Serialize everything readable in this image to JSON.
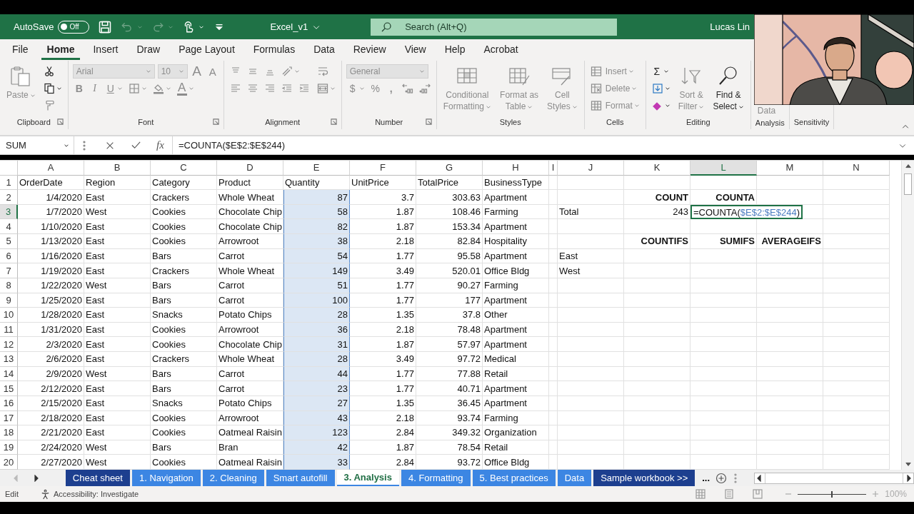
{
  "title_bar": {
    "autosave_label": "AutoSave",
    "autosave": {
      "on": false,
      "label": "Off"
    },
    "quick_access": [
      {
        "kind": "save",
        "disabled": false
      },
      {
        "kind": "undo",
        "disabled": true,
        "dropdown": true
      },
      {
        "kind": "redo",
        "disabled": true,
        "dropdown": true
      },
      {
        "kind": "touch",
        "disabled": false,
        "dropdown": true
      },
      {
        "kind": "customize",
        "disabled": false
      }
    ],
    "title": "Excel_v1",
    "search_placeholder": "Search (Alt+Q)",
    "user": "Lucas Lin"
  },
  "menu_tabs": [
    {
      "label": "File",
      "selected": false
    },
    {
      "label": "Home",
      "selected": true
    },
    {
      "label": "Insert",
      "selected": false
    },
    {
      "label": "Draw",
      "selected": false
    },
    {
      "label": "Page Layout",
      "selected": false
    },
    {
      "label": "Formulas",
      "selected": false
    },
    {
      "label": "Data",
      "selected": false
    },
    {
      "label": "Review",
      "selected": false
    },
    {
      "label": "View",
      "selected": false
    },
    {
      "label": "Help",
      "selected": false
    },
    {
      "label": "Acrobat",
      "selected": false
    }
  ],
  "ribbon": {
    "groups": [
      {
        "label": "Clipboard",
        "launcher": true,
        "columns": [
          [
            [
              {
                "kind": "paste",
                "label": [
                  "Paste"
                ],
                "disabled": true,
                "dropdown": true
              }
            ]
          ],
          [
            [
              {
                "kind": "cut",
                "disabled": false
              }
            ],
            [
              {
                "kind": "copy",
                "disabled": false,
                "dropdown": true
              }
            ],
            [
              {
                "kind": "painter",
                "disabled": true
              }
            ]
          ]
        ]
      },
      {
        "label": "Font",
        "launcher": true,
        "columns": [
          [
            [
              {
                "kind": "font-combo",
                "value": "Arial",
                "disabled": true
              },
              {
                "kind": "size-combo",
                "value": "10",
                "disabled": true
              },
              {
                "kind": "grow-glyph",
                "text": "A",
                "disabled": true
              },
              {
                "kind": "shrink-glyph",
                "text": "A",
                "disabled": true
              }
            ],
            [
              {
                "kind": "bold-glyph",
                "text": "B",
                "disabled": true
              },
              {
                "kind": "italic-glyph",
                "text": "I",
                "disabled": true
              },
              {
                "kind": "underline-glyph",
                "text": "U",
                "disabled": true,
                "dropdown": true
              },
              {
                "kind": "borders",
                "disabled": true,
                "dropdown": true
              },
              {
                "kind": "fill",
                "disabled": true,
                "dropdown": true
              },
              {
                "kind": "color-glyph",
                "text": "A",
                "disabled": true,
                "dropdown": true
              }
            ]
          ]
        ]
      },
      {
        "label": "Alignment",
        "launcher": true,
        "columns": [
          [
            [
              {
                "kind": "align-top",
                "disabled": true
              },
              {
                "kind": "align-middle",
                "disabled": true
              },
              {
                "kind": "align-bottom",
                "disabled": true
              },
              {
                "kind": "orientation",
                "disabled": true,
                "dropdown": true
              }
            ],
            [
              {
                "kind": "align-left",
                "disabled": true
              },
              {
                "kind": "align-center",
                "disabled": true
              },
              {
                "kind": "align-right",
                "disabled": true
              },
              {
                "kind": "outdent",
                "disabled": true
              },
              {
                "kind": "indent",
                "disabled": true
              }
            ]
          ],
          [
            [
              {
                "kind": "wrap",
                "disabled": true
              }
            ],
            [
              {
                "kind": "merge",
                "disabled": true,
                "dropdown": true
              }
            ]
          ]
        ]
      },
      {
        "label": "Number",
        "launcher": true,
        "columns": [
          [
            [
              {
                "kind": "format-combo",
                "value": "General",
                "disabled": true
              }
            ],
            [
              {
                "kind": "plain-glyph",
                "text": "$",
                "disabled": true,
                "dropdown": true
              },
              {
                "kind": "plain-glyph",
                "text": "%",
                "disabled": true
              },
              {
                "kind": "bold-glyph",
                "text": ",",
                "disabled": true
              },
              {
                "kind": "decimal-more",
                "disabled": true
              },
              {
                "kind": "decimal-less",
                "disabled": true
              }
            ]
          ]
        ]
      },
      {
        "label": "Styles",
        "launcher": false,
        "columns": [
          [
            [
              {
                "kind": "conditional",
                "label": [
                  "Conditional",
                  "Formatting"
                ],
                "disabled": true,
                "dropdown": true
              }
            ]
          ],
          [
            [
              {
                "kind": "table",
                "label": [
                  "Format as",
                  "Table"
                ],
                "disabled": true,
                "dropdown": true
              }
            ]
          ],
          [
            [
              {
                "kind": "styles",
                "label": [
                  "Cell",
                  "Styles"
                ],
                "disabled": true,
                "dropdown": true
              }
            ]
          ]
        ]
      },
      {
        "label": "Cells",
        "launcher": false,
        "columns": [
          [
            [
              {
                "kind": "insert-cells",
                "label": [
                  "Insert"
                ],
                "disabled": true,
                "dropdown": true
              }
            ],
            [
              {
                "kind": "delete-cells",
                "label": [
                  "Delete"
                ],
                "disabled": true,
                "dropdown": true
              }
            ],
            [
              {
                "kind": "format-cells",
                "label": [
                  "Format"
                ],
                "disabled": true,
                "dropdown": true
              }
            ]
          ]
        ]
      },
      {
        "label": "Editing",
        "launcher": false,
        "columns": [
          [
            [
              {
                "kind": "plain-glyph",
                "text": "Σ",
                "disabled": false,
                "dropdown": true
              }
            ],
            [
              {
                "kind": "fill-down",
                "disabled": false,
                "dropdown": true
              }
            ],
            [
              {
                "kind": "clear",
                "disabled": false,
                "dropdown": true
              }
            ]
          ],
          [
            [
              {
                "kind": "sort",
                "label": [
                  "Sort &",
                  "Filter"
                ],
                "disabled": true,
                "dropdown": true
              }
            ]
          ],
          [
            [
              {
                "kind": "find",
                "label": [
                  "Find &",
                  "Select"
                ],
                "disabled": false,
                "dropdown": true
              }
            ]
          ]
        ]
      },
      {
        "label": "Analysis",
        "launcher": false,
        "columns": [
          [
            [
              {
                "kind": "hidden",
                "label": [
                  "Data"
                ],
                "disabled": true
              }
            ]
          ]
        ]
      },
      {
        "label": "Sensitivity",
        "launcher": false
      }
    ]
  },
  "formula_bar": {
    "name_box": "SUM",
    "function_label": "fx",
    "formula": "=COUNTA($E$2:$E$244)"
  },
  "grid": {
    "columns": [
      {
        "letter": "A",
        "kind": "number",
        "selected": false,
        "referenced": false
      },
      {
        "letter": "B",
        "kind": "text",
        "selected": false,
        "referenced": false
      },
      {
        "letter": "C",
        "kind": "text",
        "selected": false,
        "referenced": false
      },
      {
        "letter": "D",
        "kind": "text",
        "selected": false,
        "referenced": false
      },
      {
        "letter": "E",
        "kind": "number",
        "selected": false,
        "referenced": true
      },
      {
        "letter": "F",
        "kind": "number",
        "selected": false,
        "referenced": false
      },
      {
        "letter": "G",
        "kind": "number",
        "selected": false,
        "referenced": false
      },
      {
        "letter": "H",
        "kind": "text",
        "selected": false,
        "referenced": false
      },
      {
        "letter": "I",
        "kind": "text",
        "selected": false,
        "referenced": false
      },
      {
        "letter": "J",
        "kind": "text",
        "selected": false,
        "referenced": false
      },
      {
        "letter": "K",
        "kind": "number",
        "selected": false,
        "referenced": false
      },
      {
        "letter": "L",
        "kind": "number",
        "selected": true,
        "referenced": false
      },
      {
        "letter": "M",
        "kind": "number",
        "selected": false,
        "referenced": false
      },
      {
        "letter": "N",
        "kind": "text",
        "selected": false,
        "referenced": false
      }
    ],
    "rows": [
      {
        "number": "1",
        "kind": "header",
        "selected": false,
        "cells": {
          "A": "OrderDate",
          "B": "Region",
          "C": "Category",
          "D": "Product",
          "E": "Quantity",
          "F": "UnitPrice",
          "G": "TotalPrice",
          "H": "BusinessType"
        }
      },
      {
        "number": "2",
        "kind": "data",
        "selected": false,
        "cells": {
          "A": "1/4/2020",
          "B": "East",
          "C": "Crackers",
          "D": "Whole Wheat",
          "E": "87",
          "F": "3.7",
          "G": "303.63",
          "H": "Apartment",
          "K": {
            "text": "COUNT",
            "bold": true
          },
          "L": {
            "text": "COUNTA",
            "bold": true
          }
        }
      },
      {
        "number": "3",
        "kind": "data",
        "selected": true,
        "cells": {
          "A": "1/7/2020",
          "B": "West",
          "C": "Cookies",
          "D": "Chocolate Chip",
          "E": "58",
          "F": "1.87",
          "G": "108.46",
          "H": "Farming",
          "J": "Total",
          "K": "243",
          "L": {
            "parts": [
              {
                "text": "=COUNTA(",
                "ref": false
              },
              {
                "text": "$E$2:$E$244",
                "ref": true
              },
              {
                "text": ")",
                "ref": false
              }
            ]
          }
        }
      },
      {
        "number": "4",
        "kind": "data",
        "selected": false,
        "cells": {
          "A": "1/10/2020",
          "B": "East",
          "C": "Cookies",
          "D": "Chocolate Chip",
          "E": "82",
          "F": "1.87",
          "G": "153.34",
          "H": "Apartment"
        }
      },
      {
        "number": "5",
        "kind": "data",
        "selected": false,
        "cells": {
          "A": "1/13/2020",
          "B": "East",
          "C": "Cookies",
          "D": "Arrowroot",
          "E": "38",
          "F": "2.18",
          "G": "82.84",
          "H": "Hospitality",
          "K": {
            "text": "COUNTIFS",
            "bold": true
          },
          "L": {
            "text": "SUMIFS",
            "bold": true
          },
          "M": {
            "text": "AVERAGEIFS",
            "bold": true
          }
        }
      },
      {
        "number": "6",
        "kind": "data",
        "selected": false,
        "cells": {
          "A": "1/16/2020",
          "B": "East",
          "C": "Bars",
          "D": "Carrot",
          "E": "54",
          "F": "1.77",
          "G": "95.58",
          "H": "Apartment",
          "J": "East"
        }
      },
      {
        "number": "7",
        "kind": "data",
        "selected": false,
        "cells": {
          "A": "1/19/2020",
          "B": "East",
          "C": "Crackers",
          "D": "Whole Wheat",
          "E": "149",
          "F": "3.49",
          "G": "520.01",
          "H": "Office Bldg",
          "J": "West"
        }
      },
      {
        "number": "8",
        "kind": "data",
        "selected": false,
        "cells": {
          "A": "1/22/2020",
          "B": "West",
          "C": "Bars",
          "D": "Carrot",
          "E": "51",
          "F": "1.77",
          "G": "90.27",
          "H": "Farming"
        }
      },
      {
        "number": "9",
        "kind": "data",
        "selected": false,
        "cells": {
          "A": "1/25/2020",
          "B": "East",
          "C": "Bars",
          "D": "Carrot",
          "E": "100",
          "F": "1.77",
          "G": "177",
          "H": "Apartment"
        }
      },
      {
        "number": "10",
        "kind": "data",
        "selected": false,
        "cells": {
          "A": "1/28/2020",
          "B": "East",
          "C": "Snacks",
          "D": "Potato Chips",
          "E": "28",
          "F": "1.35",
          "G": "37.8",
          "H": "Other"
        }
      },
      {
        "number": "11",
        "kind": "data",
        "selected": false,
        "cells": {
          "A": "1/31/2020",
          "B": "East",
          "C": "Cookies",
          "D": "Arrowroot",
          "E": "36",
          "F": "2.18",
          "G": "78.48",
          "H": "Apartment"
        }
      },
      {
        "number": "12",
        "kind": "data",
        "selected": false,
        "cells": {
          "A": "2/3/2020",
          "B": "East",
          "C": "Cookies",
          "D": "Chocolate Chip",
          "E": "31",
          "F": "1.87",
          "G": "57.97",
          "H": "Apartment"
        }
      },
      {
        "number": "13",
        "kind": "data",
        "selected": false,
        "cells": {
          "A": "2/6/2020",
          "B": "East",
          "C": "Crackers",
          "D": "Whole Wheat",
          "E": "28",
          "F": "3.49",
          "G": "97.72",
          "H": "Medical"
        }
      },
      {
        "number": "14",
        "kind": "data",
        "selected": false,
        "cells": {
          "A": "2/9/2020",
          "B": "West",
          "C": "Bars",
          "D": "Carrot",
          "E": "44",
          "F": "1.77",
          "G": "77.88",
          "H": "Retail"
        }
      },
      {
        "number": "15",
        "kind": "data",
        "selected": false,
        "cells": {
          "A": "2/12/2020",
          "B": "East",
          "C": "Bars",
          "D": "Carrot",
          "E": "23",
          "F": "1.77",
          "G": "40.71",
          "H": "Apartment"
        }
      },
      {
        "number": "16",
        "kind": "data",
        "selected": false,
        "cells": {
          "A": "2/15/2020",
          "B": "East",
          "C": "Snacks",
          "D": "Potato Chips",
          "E": "27",
          "F": "1.35",
          "G": "36.45",
          "H": "Apartment"
        }
      },
      {
        "number": "17",
        "kind": "data",
        "selected": false,
        "cells": {
          "A": "2/18/2020",
          "B": "East",
          "C": "Cookies",
          "D": "Arrowroot",
          "E": "43",
          "F": "2.18",
          "G": "93.74",
          "H": "Farming"
        }
      },
      {
        "number": "18",
        "kind": "data",
        "selected": false,
        "cells": {
          "A": "2/21/2020",
          "B": "East",
          "C": "Cookies",
          "D": "Oatmeal Raisin",
          "E": "123",
          "F": "2.84",
          "G": "349.32",
          "H": "Organization"
        }
      },
      {
        "number": "19",
        "kind": "data",
        "selected": false,
        "cells": {
          "A": "2/24/2020",
          "B": "West",
          "C": "Bars",
          "D": "Bran",
          "E": "42",
          "F": "1.87",
          "G": "78.54",
          "H": "Retail"
        }
      },
      {
        "number": "20",
        "kind": "data",
        "selected": false,
        "cells": {
          "A": "2/27/2020",
          "B": "West",
          "C": "Cookies",
          "D": "Oatmeal Raisin",
          "E": "33",
          "F": "2.84",
          "G": "93.72",
          "H": "Office Bldg"
        }
      }
    ]
  },
  "sheet_tabs": [
    {
      "label": "Cheat sheet",
      "color": "#1d3f8f",
      "selected": false
    },
    {
      "label": "1. Navigation",
      "color": "#3c86e3",
      "selected": false
    },
    {
      "label": "2. Cleaning",
      "color": "#3c86e3",
      "selected": false
    },
    {
      "label": "Smart autofill",
      "color": "#3c86e3",
      "selected": false
    },
    {
      "label": "3. Analysis",
      "color": "#3c86e3",
      "selected": true
    },
    {
      "label": "4. Formatting",
      "color": "#3c86e3",
      "selected": false
    },
    {
      "label": "5. Best practices",
      "color": "#3c86e3",
      "selected": false
    },
    {
      "label": "Data",
      "color": "#3c86e3",
      "selected": false
    },
    {
      "label": "Sample workbook >>",
      "color": "#1d3f8f",
      "selected": false
    }
  ],
  "sheet_more": "...",
  "status_bar": {
    "mode": "Edit",
    "accessibility": "Accessibility: Investigate",
    "zoom": {
      "level": 0.5,
      "label": "100%"
    }
  }
}
